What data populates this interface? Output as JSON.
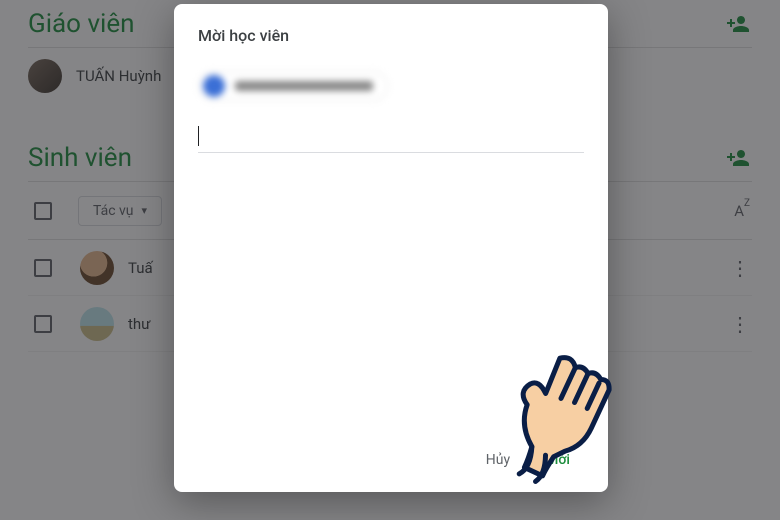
{
  "sections": {
    "teachers": {
      "title": "Giáo viên",
      "rows": [
        {
          "name": "TUẤN Huỳnh"
        }
      ]
    },
    "students": {
      "title": "Sinh viên",
      "actions_label": "Tác vụ",
      "sort_label": "AZ",
      "rows": [
        {
          "name": "Tuấ"
        },
        {
          "name": "thư"
        }
      ]
    }
  },
  "modal": {
    "title": "Mời học viên",
    "cancel_label": "Hủy",
    "invite_label": "Mời"
  }
}
